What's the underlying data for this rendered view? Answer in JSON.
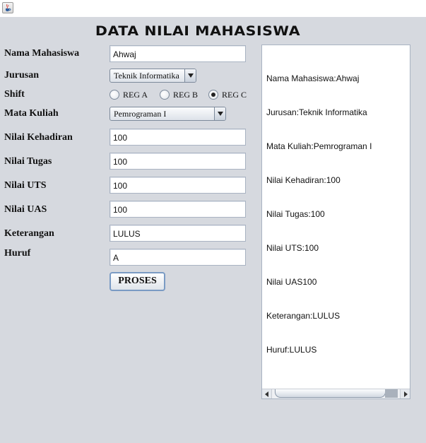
{
  "form": {
    "title": "DATA NILAI MAHASISWA",
    "labels": {
      "nama": "Nama Mahasiswa",
      "jurusan": "Jurusan",
      "shift": "Shift",
      "mata_kuliah": "Mata Kuliah",
      "kehadiran": "Nilai Kehadiran",
      "tugas": "Nilai Tugas",
      "uts": "Nilai UTS",
      "uas": "Nilai UAS",
      "keterangan": "Keterangan",
      "huruf": "Huruf"
    },
    "values": {
      "nama": "Ahwaj",
      "jurusan": "Teknik Informatika",
      "mata_kuliah": "Pemrograman I",
      "kehadiran": "100",
      "tugas": "100",
      "uts": "100",
      "uas": "100",
      "keterangan": "LULUS",
      "huruf": "A"
    },
    "shift_options": [
      "REG A",
      "REG B",
      "REG C"
    ],
    "shift_selected": "REG C",
    "button_label": "PROSES"
  },
  "output": {
    "lines": [
      "Nama Mahasiswa:Ahwaj",
      "Jurusan:Teknik Informatika",
      "Mata Kuliah:Pemrograman I",
      "Nilai Kehadiran:100",
      "Nilai Tugas:100",
      "Nilai UTS:100",
      "Nilai UAS100",
      "Keterangan:LULUS",
      "Huruf:LULUS"
    ]
  },
  "icons": {
    "window": "java-cup-icon",
    "dropdown": "chevron-down-icon",
    "scroll_left": "arrow-left-icon",
    "scroll_right": "arrow-right-icon"
  }
}
